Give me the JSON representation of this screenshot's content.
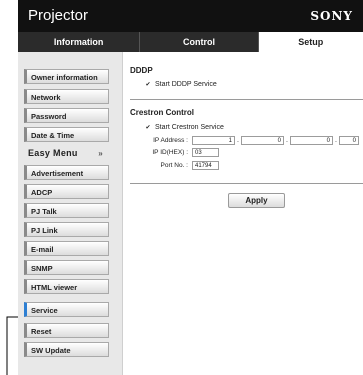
{
  "header": {
    "title": "Projector",
    "brand": "SONY"
  },
  "tabs": [
    {
      "label": "Information"
    },
    {
      "label": "Control"
    },
    {
      "label": "Setup"
    }
  ],
  "sidebar": {
    "items": [
      {
        "label": "Owner information"
      },
      {
        "label": "Network"
      },
      {
        "label": "Password"
      },
      {
        "label": "Date & Time"
      },
      {
        "label": "Easy Menu",
        "chevron": "»"
      },
      {
        "label": "Advertisement"
      },
      {
        "label": "ADCP"
      },
      {
        "label": "PJ Talk"
      },
      {
        "label": "PJ Link"
      },
      {
        "label": "E-mail"
      },
      {
        "label": "SNMP"
      },
      {
        "label": "HTML viewer"
      },
      {
        "label": "Service"
      },
      {
        "label": "Reset"
      },
      {
        "label": "SW Update"
      }
    ],
    "selected": "Service"
  },
  "ddp": {
    "title": "DDDP",
    "checkbox_label": "Start DDDP Service",
    "checked": true
  },
  "crestron": {
    "title": "Crestron Control",
    "checkbox_label": "Start Crestron Service",
    "checked": true,
    "ip_label": "IP Address :",
    "ip": [
      "1",
      "0",
      "0",
      "0"
    ],
    "ipid_label": "IP ID(HEX) :",
    "ipid": "03",
    "port_label": "Port No. :",
    "port": "41794"
  },
  "apply_label": "Apply",
  "colors": {
    "header": "#111111",
    "tab_bg": "#2b2b2b",
    "selected_accent": "#2d7fd3"
  }
}
